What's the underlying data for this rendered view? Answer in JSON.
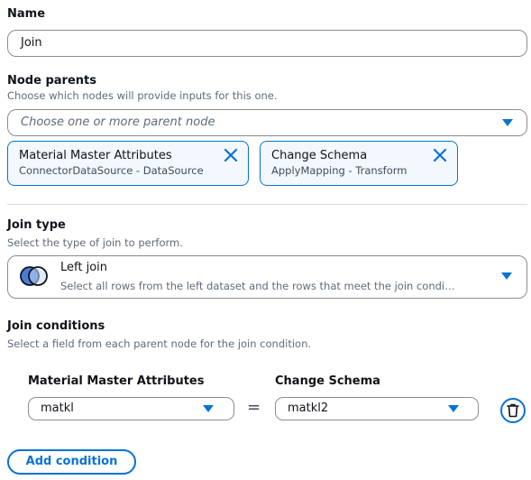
{
  "name": {
    "label": "Name",
    "value": "Join"
  },
  "node_parents": {
    "label": "Node parents",
    "description": "Choose which nodes will provide inputs for this one.",
    "placeholder": "Choose one or more parent node",
    "tokens": [
      {
        "title": "Material Master Attributes",
        "subtitle": "ConnectorDataSource - DataSource"
      },
      {
        "title": "Change Schema",
        "subtitle": "ApplyMapping - Transform"
      }
    ]
  },
  "join_type": {
    "label": "Join type",
    "description": "Select the type of join to perform.",
    "selected_label": "Left join",
    "selected_description": "Select all rows from the left dataset and the rows that meet the join condi…",
    "icon": "venn-left-join-icon"
  },
  "join_conditions": {
    "label": "Join conditions",
    "description": "Select a field from each parent node for the join condition.",
    "left_header": "Material Master Attributes",
    "right_header": "Change Schema",
    "operator": "=",
    "conditions": [
      {
        "left": "matkl",
        "right": "matkl2"
      }
    ]
  },
  "add_condition_label": "Add condition",
  "colors": {
    "accent": "#0972d3",
    "token_bg": "#f2f8fd",
    "border": "#8c8c94",
    "muted": "#5f6b7a"
  }
}
